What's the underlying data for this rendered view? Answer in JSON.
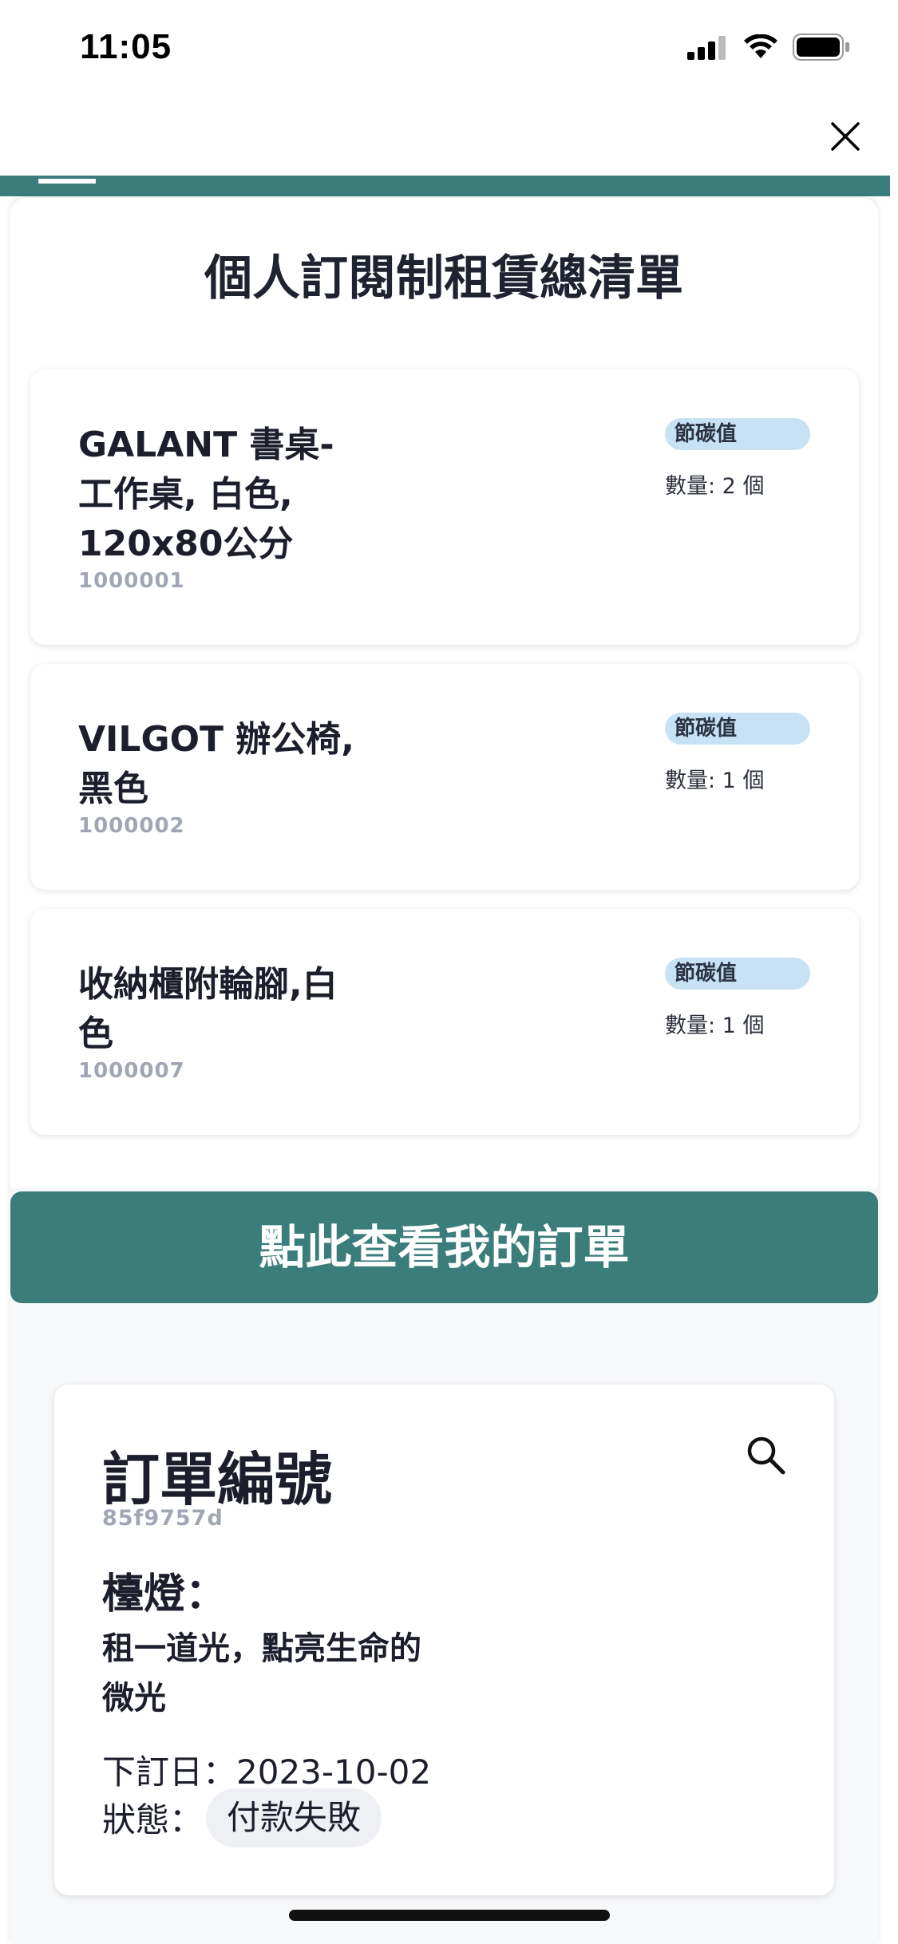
{
  "status_bar": {
    "time": "11:05"
  },
  "page_title": "個人訂閱制租賃總清單",
  "items": [
    {
      "name": "GALANT 書桌-\n工作桌, 白色,\n120x80公分",
      "code": "1000001",
      "badge": "節碳值",
      "quantity": "數量: 2 個"
    },
    {
      "name": "VILGOT 辦公椅,\n黑色",
      "code": "1000002",
      "badge": "節碳值",
      "quantity": "數量: 1 個"
    },
    {
      "name": "收納櫃附輪腳,白\n色",
      "code": "1000007",
      "badge": "節碳值",
      "quantity": "數量: 1 個"
    }
  ],
  "view_orders_button": "點此查看我的訂單",
  "order": {
    "title": "訂單編號",
    "id": "85f9757d",
    "heading": "檯燈：",
    "subtitle": "租一道光，點亮生命的微光",
    "date": "下訂日：2023-10-02",
    "status_label": "狀態：",
    "status": "付款失敗"
  },
  "colors": {
    "accent": "#3a7d7b",
    "badge_bg": "#c7e1f5",
    "muted_text": "#a0a6b4"
  }
}
